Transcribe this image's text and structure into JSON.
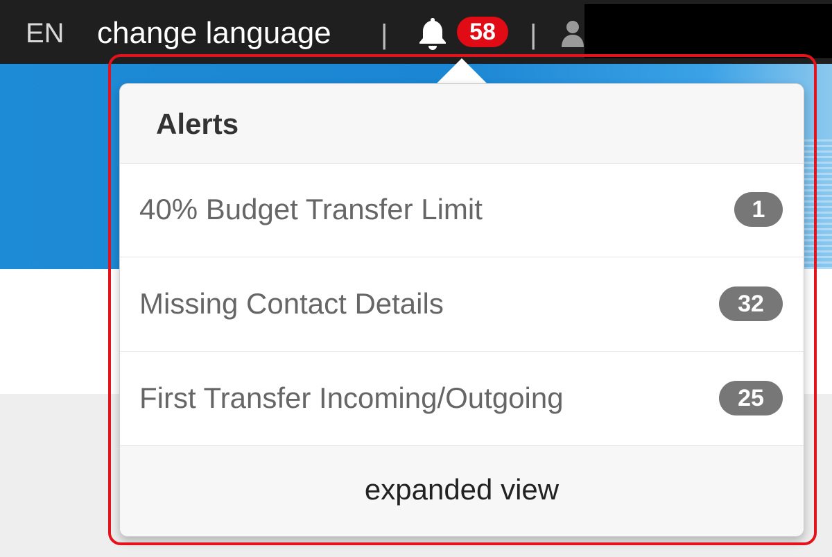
{
  "nav": {
    "language_code": "EN",
    "change_language": "change language",
    "separator": "|",
    "notification_count": "58"
  },
  "alerts": {
    "title": "Alerts",
    "items": [
      {
        "label": "40% Budget Transfer Limit",
        "count": "1"
      },
      {
        "label": "Missing Contact Details",
        "count": "32"
      },
      {
        "label": "First Transfer Incoming/Outgoing",
        "count": "25"
      }
    ],
    "footer_link": "expanded view"
  },
  "icons": {
    "notifications": "bell-icon",
    "user": "user-icon"
  },
  "colors": {
    "topbar": "#1f1f1f",
    "badge_red": "#e00b14",
    "count_badge": "#777777",
    "banner_blue": "#1e8bd6",
    "highlight_red": "#e3121b"
  }
}
